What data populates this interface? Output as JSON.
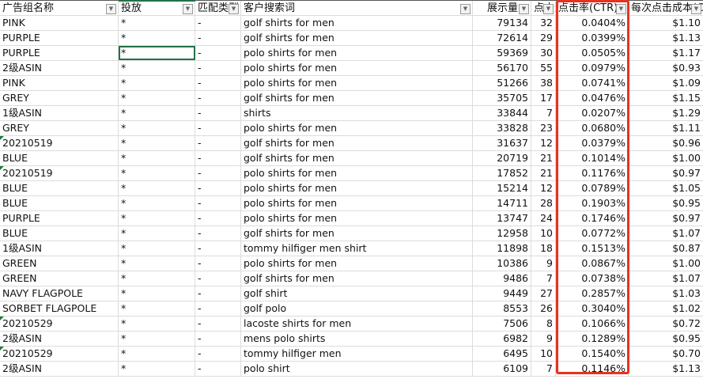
{
  "headers": [
    "广告组名称",
    "投放",
    "匹配类型",
    "客户搜索词",
    "展示量",
    "点击量",
    "点击率(CTR)",
    "每次点击成本(CPC)"
  ],
  "rows": [
    [
      "PINK",
      "*",
      "-",
      "golf shirts for men",
      "79134",
      "32",
      "0.0404%",
      "$1.10"
    ],
    [
      "PURPLE",
      "*",
      "-",
      "golf shirts for men",
      "72614",
      "29",
      "0.0399%",
      "$1.13"
    ],
    [
      "PURPLE",
      "*",
      "-",
      "polo shirts for men",
      "59369",
      "30",
      "0.0505%",
      "$1.17"
    ],
    [
      "2级ASIN",
      "*",
      "-",
      "polo shirts for men",
      "56170",
      "55",
      "0.0979%",
      "$0.93"
    ],
    [
      "PINK",
      "*",
      "-",
      "polo shirts for men",
      "51266",
      "38",
      "0.0741%",
      "$1.09"
    ],
    [
      "GREY",
      "*",
      "-",
      "golf shirts for men",
      "35705",
      "17",
      "0.0476%",
      "$1.15"
    ],
    [
      "1级ASIN",
      "*",
      "-",
      "shirts",
      "33844",
      "7",
      "0.0207%",
      "$1.29"
    ],
    [
      "GREY",
      "*",
      "-",
      "polo shirts for men",
      "33828",
      "23",
      "0.0680%",
      "$1.11"
    ],
    [
      "20210519",
      "*",
      "-",
      "golf shirts for men",
      "31637",
      "12",
      "0.0379%",
      "$0.96"
    ],
    [
      "BLUE",
      "*",
      "-",
      "golf shirts for men",
      "20719",
      "21",
      "0.1014%",
      "$1.00"
    ],
    [
      "20210519",
      "*",
      "-",
      "polo shirts for men",
      "17852",
      "21",
      "0.1176%",
      "$0.97"
    ],
    [
      "BLUE",
      "*",
      "-",
      "polo shirts for men",
      "15214",
      "12",
      "0.0789%",
      "$1.05"
    ],
    [
      "BLUE",
      "*",
      "-",
      "polo shirts for men",
      "14711",
      "28",
      "0.1903%",
      "$0.95"
    ],
    [
      "PURPLE",
      "*",
      "-",
      "polo shirts for men",
      "13747",
      "24",
      "0.1746%",
      "$0.97"
    ],
    [
      "BLUE",
      "*",
      "-",
      "golf shirts for men",
      "12958",
      "10",
      "0.0772%",
      "$1.07"
    ],
    [
      "1级ASIN",
      "*",
      "-",
      "tommy hilfiger men shirt",
      "11898",
      "18",
      "0.1513%",
      "$0.87"
    ],
    [
      "GREEN",
      "*",
      "-",
      "polo shirts for men",
      "10386",
      "9",
      "0.0867%",
      "$1.00"
    ],
    [
      "GREEN",
      "*",
      "-",
      "golf shirts for men",
      "9486",
      "7",
      "0.0738%",
      "$1.07"
    ],
    [
      "NAVY FLAGPOLE",
      "*",
      "-",
      "golf shirt",
      "9449",
      "27",
      "0.2857%",
      "$1.03"
    ],
    [
      "SORBET FLAGPOLE",
      "*",
      "-",
      "golf polo",
      "8553",
      "26",
      "0.3040%",
      "$1.02"
    ],
    [
      "20210529",
      "*",
      "-",
      "lacoste shirts for men",
      "7506",
      "8",
      "0.1066%",
      "$0.72"
    ],
    [
      "2级ASIN",
      "*",
      "-",
      "mens polo shirts",
      "6982",
      "9",
      "0.1289%",
      "$0.95"
    ],
    [
      "20210529",
      "*",
      "-",
      "tommy hilfiger men",
      "6495",
      "10",
      "0.1540%",
      "$0.70"
    ],
    [
      "2级ASIN",
      "*",
      "-",
      "polo shirt",
      "6109",
      "7",
      "0.1146%",
      "$1.13"
    ]
  ],
  "colors": {
    "highlight": "#e8321f",
    "selection": "#217346"
  }
}
